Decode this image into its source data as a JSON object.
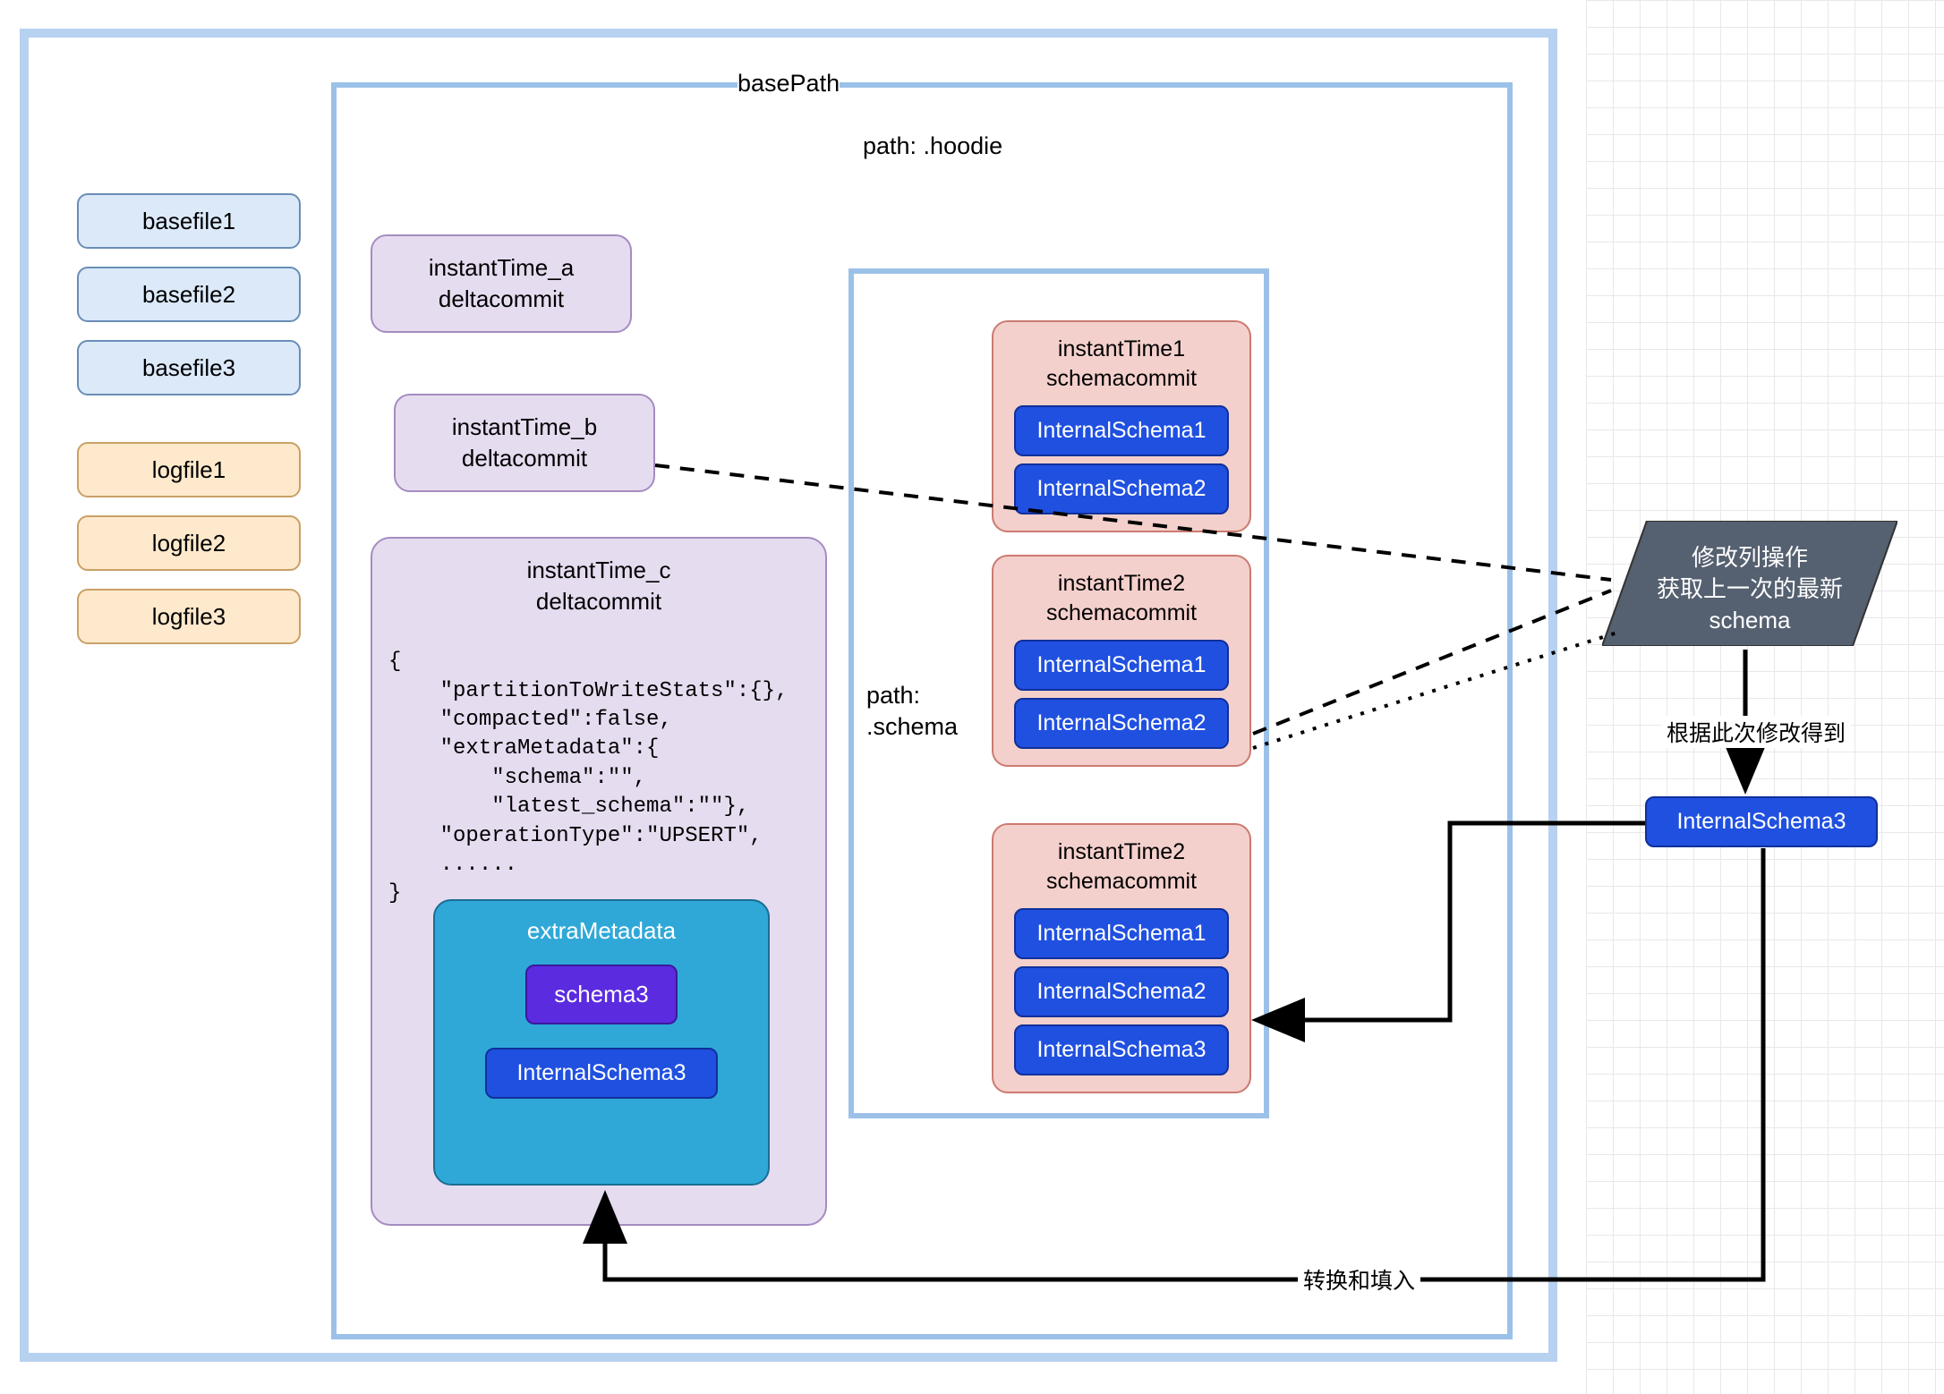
{
  "labels": {
    "basePath": "basePath",
    "hoodiePath": "path: .hoodie",
    "schemaPath": "path: .schema"
  },
  "basefiles": [
    "basefile1",
    "basefile2",
    "basefile3"
  ],
  "logfiles": [
    "logfile1",
    "logfile2",
    "logfile3"
  ],
  "deltaCommits": {
    "a": {
      "line1": "instantTime_a",
      "line2": "deltacommit"
    },
    "b": {
      "line1": "instantTime_b",
      "line2": "deltacommit"
    },
    "c": {
      "line1": "instantTime_c",
      "line2": "deltacommit"
    }
  },
  "jsonBlock": "{\n    \"partitionToWriteStats\":{},\n    \"compacted\":false,\n    \"extraMetadata\":{\n        \"schema\":\"\",\n        \"latest_schema\":\"\"},\n    \"operationType\":\"UPSERT\",\n    ......\n}",
  "extraMetadata": {
    "title": "extraMetadata",
    "schema": "schema3",
    "internal": "InternalSchema3"
  },
  "schemaCommits": [
    {
      "line1": "instantTime1",
      "line2": "schemacommit",
      "items": [
        "InternalSchema1",
        "InternalSchema2"
      ]
    },
    {
      "line1": "instantTime2",
      "line2": "schemacommit",
      "items": [
        "InternalSchema1",
        "InternalSchema2"
      ]
    },
    {
      "line1": "instantTime2",
      "line2": "schemacommit",
      "items": [
        "InternalSchema1",
        "InternalSchema2",
        "InternalSchema3"
      ]
    }
  ],
  "paral": {
    "l1": "修改列操作",
    "l2": "获取上一次的最新",
    "l3": "schema"
  },
  "arrowLabels": {
    "derive": "根据此次修改得到",
    "convert": "转换和填入"
  },
  "external": {
    "schema3": "InternalSchema3"
  }
}
